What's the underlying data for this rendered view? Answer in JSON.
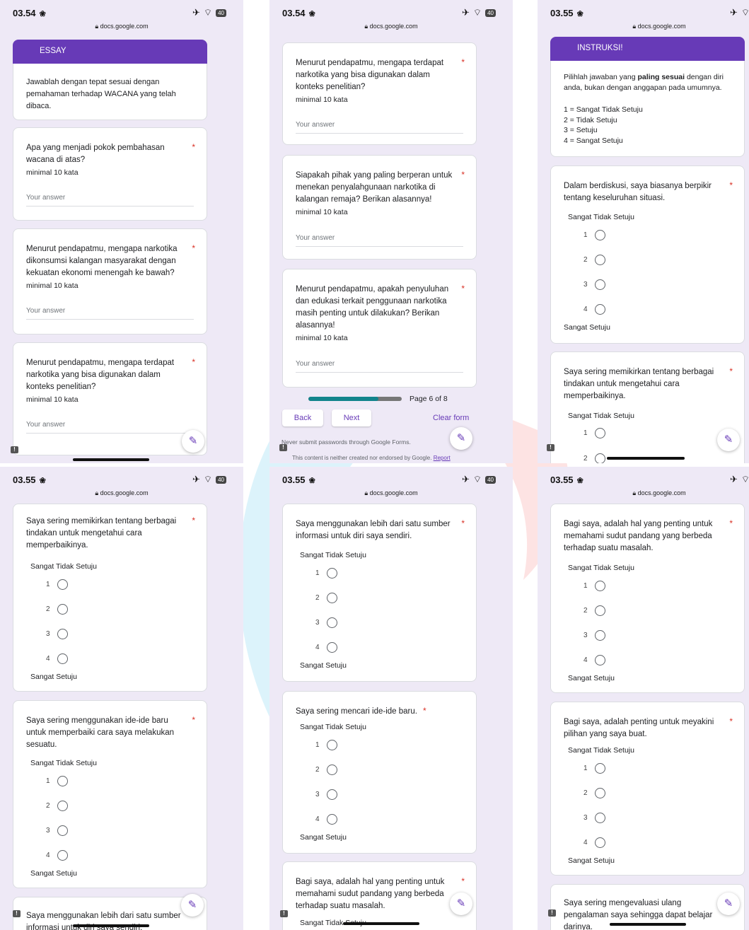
{
  "colors": {
    "accent": "#673ab7",
    "required": "#d93025",
    "panel_bg": "#eee9f6"
  },
  "status": {
    "url": "docs.google.com"
  },
  "panels": [
    {
      "time": "03.54",
      "header": "ESSAY",
      "intro": "Jawablah dengan tepat sesuai dengan pemahaman terhadap WACANA yang telah dibaca.",
      "questions": [
        {
          "text": "Apa yang menjadi pokok pembahasan wacana di atas?",
          "sub": "minimal 10 kata",
          "answer": "Your answer"
        },
        {
          "text": "Menurut pendapatmu, mengapa narkotika dikonsumsi kalangan masyarakat dengan kekuatan ekonomi menengah ke bawah?",
          "sub": "minimal 10 kata",
          "answer": "Your answer"
        },
        {
          "text": "Menurut pendapatmu, mengapa terdapat narkotika yang bisa digunakan dalam konteks penelitian?",
          "sub": "minimal 10 kata",
          "answer": "Your answer"
        }
      ]
    },
    {
      "time": "03.54",
      "questions": [
        {
          "text": "Menurut pendapatmu, mengapa terdapat narkotika yang bisa digunakan dalam konteks penelitian?",
          "sub": "minimal 10 kata",
          "answer": "Your answer"
        },
        {
          "text": "Siapakah pihak yang paling berperan untuk menekan penyalahgunaan narkotika di kalangan remaja? Berikan alasannya!",
          "sub": "minimal 10 kata",
          "answer": "Your answer"
        },
        {
          "text": "Menurut pendapatmu, apakah penyuluhan dan edukasi terkait penggunaan narkotika masih penting untuk dilakukan? Berikan alasannya!",
          "sub": "minimal 10 kata",
          "answer": "Your answer"
        }
      ],
      "page_label": "Page 6 of 8",
      "progress": 0.75,
      "back": "Back",
      "next": "Next",
      "clear": "Clear form",
      "never_submit": "Never submit passwords through Google Forms.",
      "footer": "This content is neither created nor endorsed by Google.",
      "report": "Report"
    },
    {
      "time": "03.55",
      "header": "INSTRUKSI!",
      "instr_pre": "Pilihlah jawaban yang ",
      "instr_bold": "paling sesuai",
      "instr_post": " dengan diri anda, bukan dengan anggapan pada umumnya.",
      "scale_list": [
        "1 = Sangat Tidak Setuju",
        "2 = Tidak Setuju",
        "3 = Setuju",
        "4 = Sangat Setuju"
      ],
      "questions": [
        {
          "text": "Dalam berdiskusi, saya biasanya berpikir tentang keseluruhan situasi.",
          "low": "Sangat Tidak Setuju",
          "high": "Sangat Setuju",
          "options": [
            "1",
            "2",
            "3",
            "4"
          ]
        },
        {
          "text": "Saya sering memikirkan tentang berbagai tindakan untuk mengetahui cara memperbaikinya.",
          "low": "Sangat Tidak Setuju",
          "options": [
            "1",
            "2"
          ]
        }
      ]
    },
    {
      "time": "03.55",
      "questions": [
        {
          "text": "Saya sering memikirkan tentang berbagai tindakan untuk mengetahui cara memperbaikinya.",
          "low": "Sangat Tidak Setuju",
          "high": "Sangat Setuju",
          "options": [
            "1",
            "2",
            "3",
            "4"
          ]
        },
        {
          "text": "Saya sering menggunakan ide-ide baru untuk memperbaiki cara saya melakukan sesuatu.",
          "low": "Sangat Tidak Setuju",
          "high": "Sangat Setuju",
          "options": [
            "1",
            "2",
            "3",
            "4"
          ]
        },
        {
          "text": "Saya menggunakan lebih dari satu sumber informasi untuk diri saya sendiri."
        }
      ]
    },
    {
      "time": "03.55",
      "questions": [
        {
          "text": "Saya menggunakan lebih dari satu sumber informasi untuk diri saya sendiri.",
          "low": "Sangat Tidak Setuju",
          "high": "Sangat Setuju",
          "options": [
            "1",
            "2",
            "3",
            "4"
          ]
        },
        {
          "text": "Saya sering mencari ide-ide baru.",
          "low": "Sangat Tidak Setuju",
          "high": "Sangat Setuju",
          "options": [
            "1",
            "2",
            "3",
            "4"
          ]
        },
        {
          "text": "Bagi saya, adalah hal yang penting untuk memahami sudut pandang yang berbeda terhadap suatu masalah.",
          "low": "Sangat Tidak Setuju"
        }
      ]
    },
    {
      "time": "03.55",
      "questions": [
        {
          "text": "Bagi saya, adalah hal yang penting untuk memahami sudut pandang yang berbeda terhadap suatu masalah.",
          "low": "Sangat Tidak Setuju",
          "high": "Sangat Setuju",
          "options": [
            "1",
            "2",
            "3",
            "4"
          ]
        },
        {
          "text": "Bagi saya, adalah penting untuk meyakini pilihan yang saya buat.",
          "low": "Sangat Tidak Setuju",
          "high": "Sangat Setuju",
          "options": [
            "1",
            "2",
            "3",
            "4"
          ]
        },
        {
          "text": "Saya sering mengevaluasi ulang pengalaman saya sehingga dapat belajar darinya."
        }
      ]
    }
  ]
}
